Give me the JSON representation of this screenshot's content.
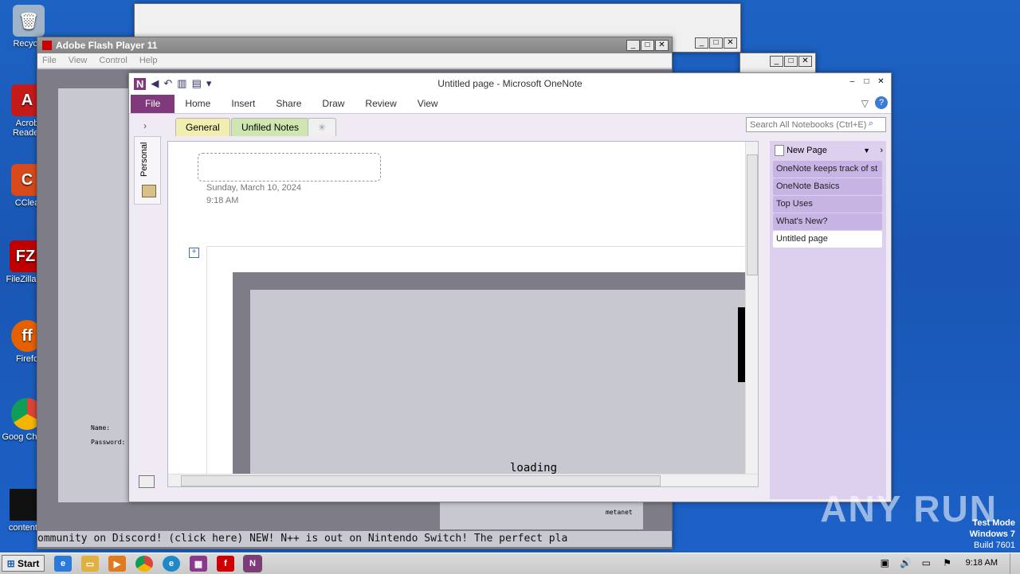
{
  "desktop": {
    "icons": [
      {
        "label": "Recycle",
        "name": "recycle-bin-icon"
      },
      {
        "label": "Acrob Reader",
        "name": "acrobat-reader-icon"
      },
      {
        "label": "CClea",
        "name": "ccleaner-icon"
      },
      {
        "label": "FileZilla C",
        "name": "filezilla-icon"
      },
      {
        "label": "Firefo",
        "name": "firefox-icon"
      },
      {
        "label": "Goog Chrom",
        "name": "chrome-icon"
      },
      {
        "label": "contenta",
        "name": "content-file-icon"
      }
    ],
    "watermark": "ANY RUN",
    "test_mode": [
      "Test Mode",
      "Windows 7",
      "Build 7601"
    ]
  },
  "flash": {
    "title": "Adobe Flash Player 11",
    "menu": [
      "File",
      "View",
      "Control",
      "Help"
    ],
    "login": {
      "name_label": "Name:",
      "password_label": "Password:"
    },
    "ticker": "ommunity on Discord! (click here)     NEW! N++ is out on Nintendo Switch! The perfect pla",
    "player_tag": "metanet"
  },
  "onenote": {
    "title": "Untitled page  -  Microsoft OneNote",
    "ribbon_tabs": [
      "File",
      "Home",
      "Insert",
      "Share",
      "Draw",
      "Review",
      "View"
    ],
    "notebook_label": "Personal",
    "section_tabs": [
      "General",
      "Unfiled Notes"
    ],
    "search_placeholder": "Search All Notebooks (Ctrl+E)",
    "page_date": "Sunday, March 10, 2024",
    "page_time": "9:18 AM",
    "embedded_loading": "loading",
    "new_page_label": "New Page",
    "pages": [
      "OneNote keeps track of st",
      "OneNote Basics",
      "Top Uses",
      "What's New?",
      "Untitled page"
    ],
    "selected_page_index": 4
  },
  "taskbar": {
    "start": "Start",
    "clock": "9:18 AM"
  },
  "colors": {
    "desktop_blue": "#1d63c4",
    "onenote_purple": "#80397b",
    "pane_lilac": "#ddd0ee"
  }
}
